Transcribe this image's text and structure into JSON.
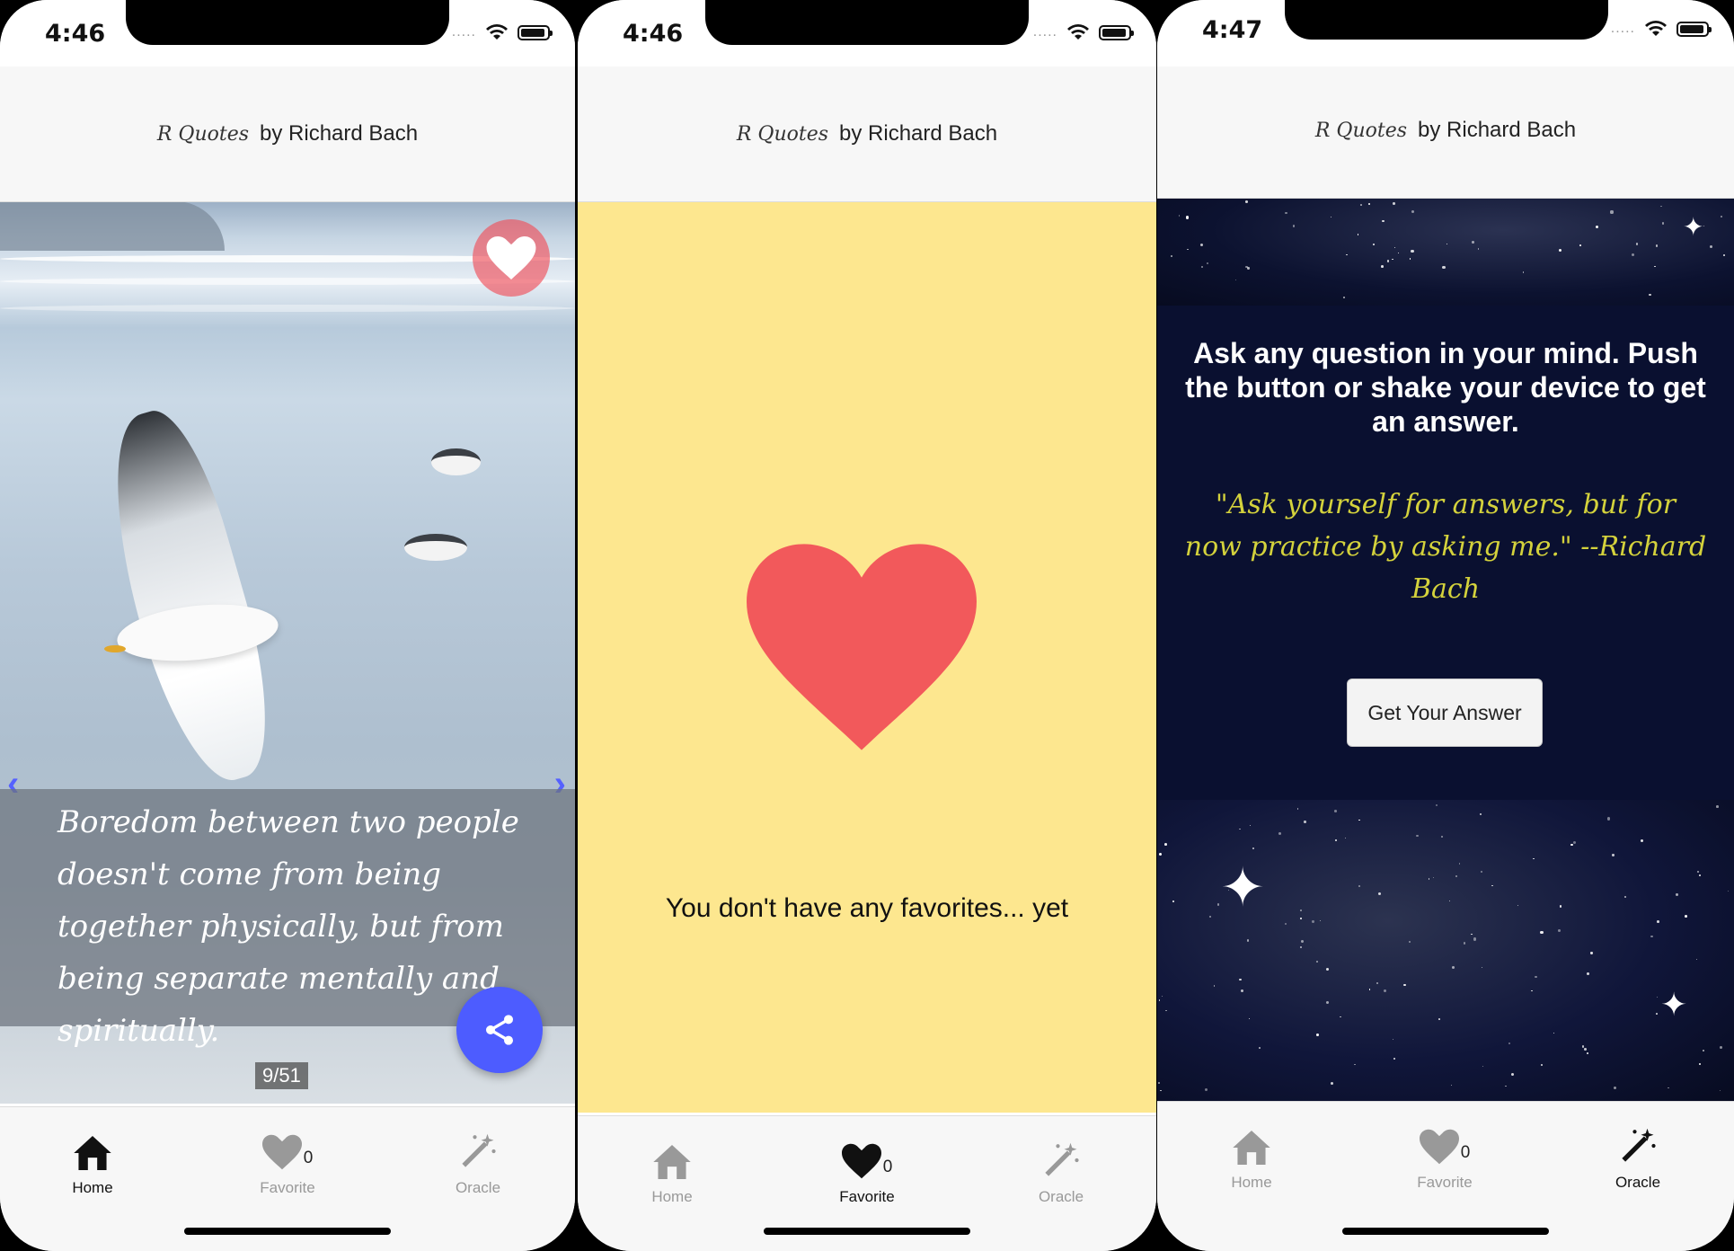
{
  "status": {
    "time_home": "4:46",
    "time_favorite": "4:46",
    "time_oracle": "4:47",
    "signal_dots": "....."
  },
  "header": {
    "brand": "R Quotes",
    "byline": "by Richard Bach"
  },
  "home": {
    "quote": "Boredom between two people doesn't come from being together physically, but from being separate mentally and spiritually.",
    "counter": "9/51",
    "prev_arrow": "‹",
    "next_arrow": "›"
  },
  "favorite": {
    "empty_message": "You don't have any favorites... yet"
  },
  "oracle": {
    "instructions": "Ask any question in your mind. Push the button or shake your device to get an answer.",
    "quote": "\"Ask yourself for answers, but for now practice by asking me.\" --Richard Bach",
    "button": "Get Your Answer"
  },
  "tabs": {
    "home": "Home",
    "favorite": "Favorite",
    "favorite_count": "0",
    "oracle": "Oracle"
  },
  "colors": {
    "accent": "#4d5cff",
    "heart": "#f2595b",
    "yellow": "#fde78f",
    "quote_gold": "#d4d23c"
  }
}
